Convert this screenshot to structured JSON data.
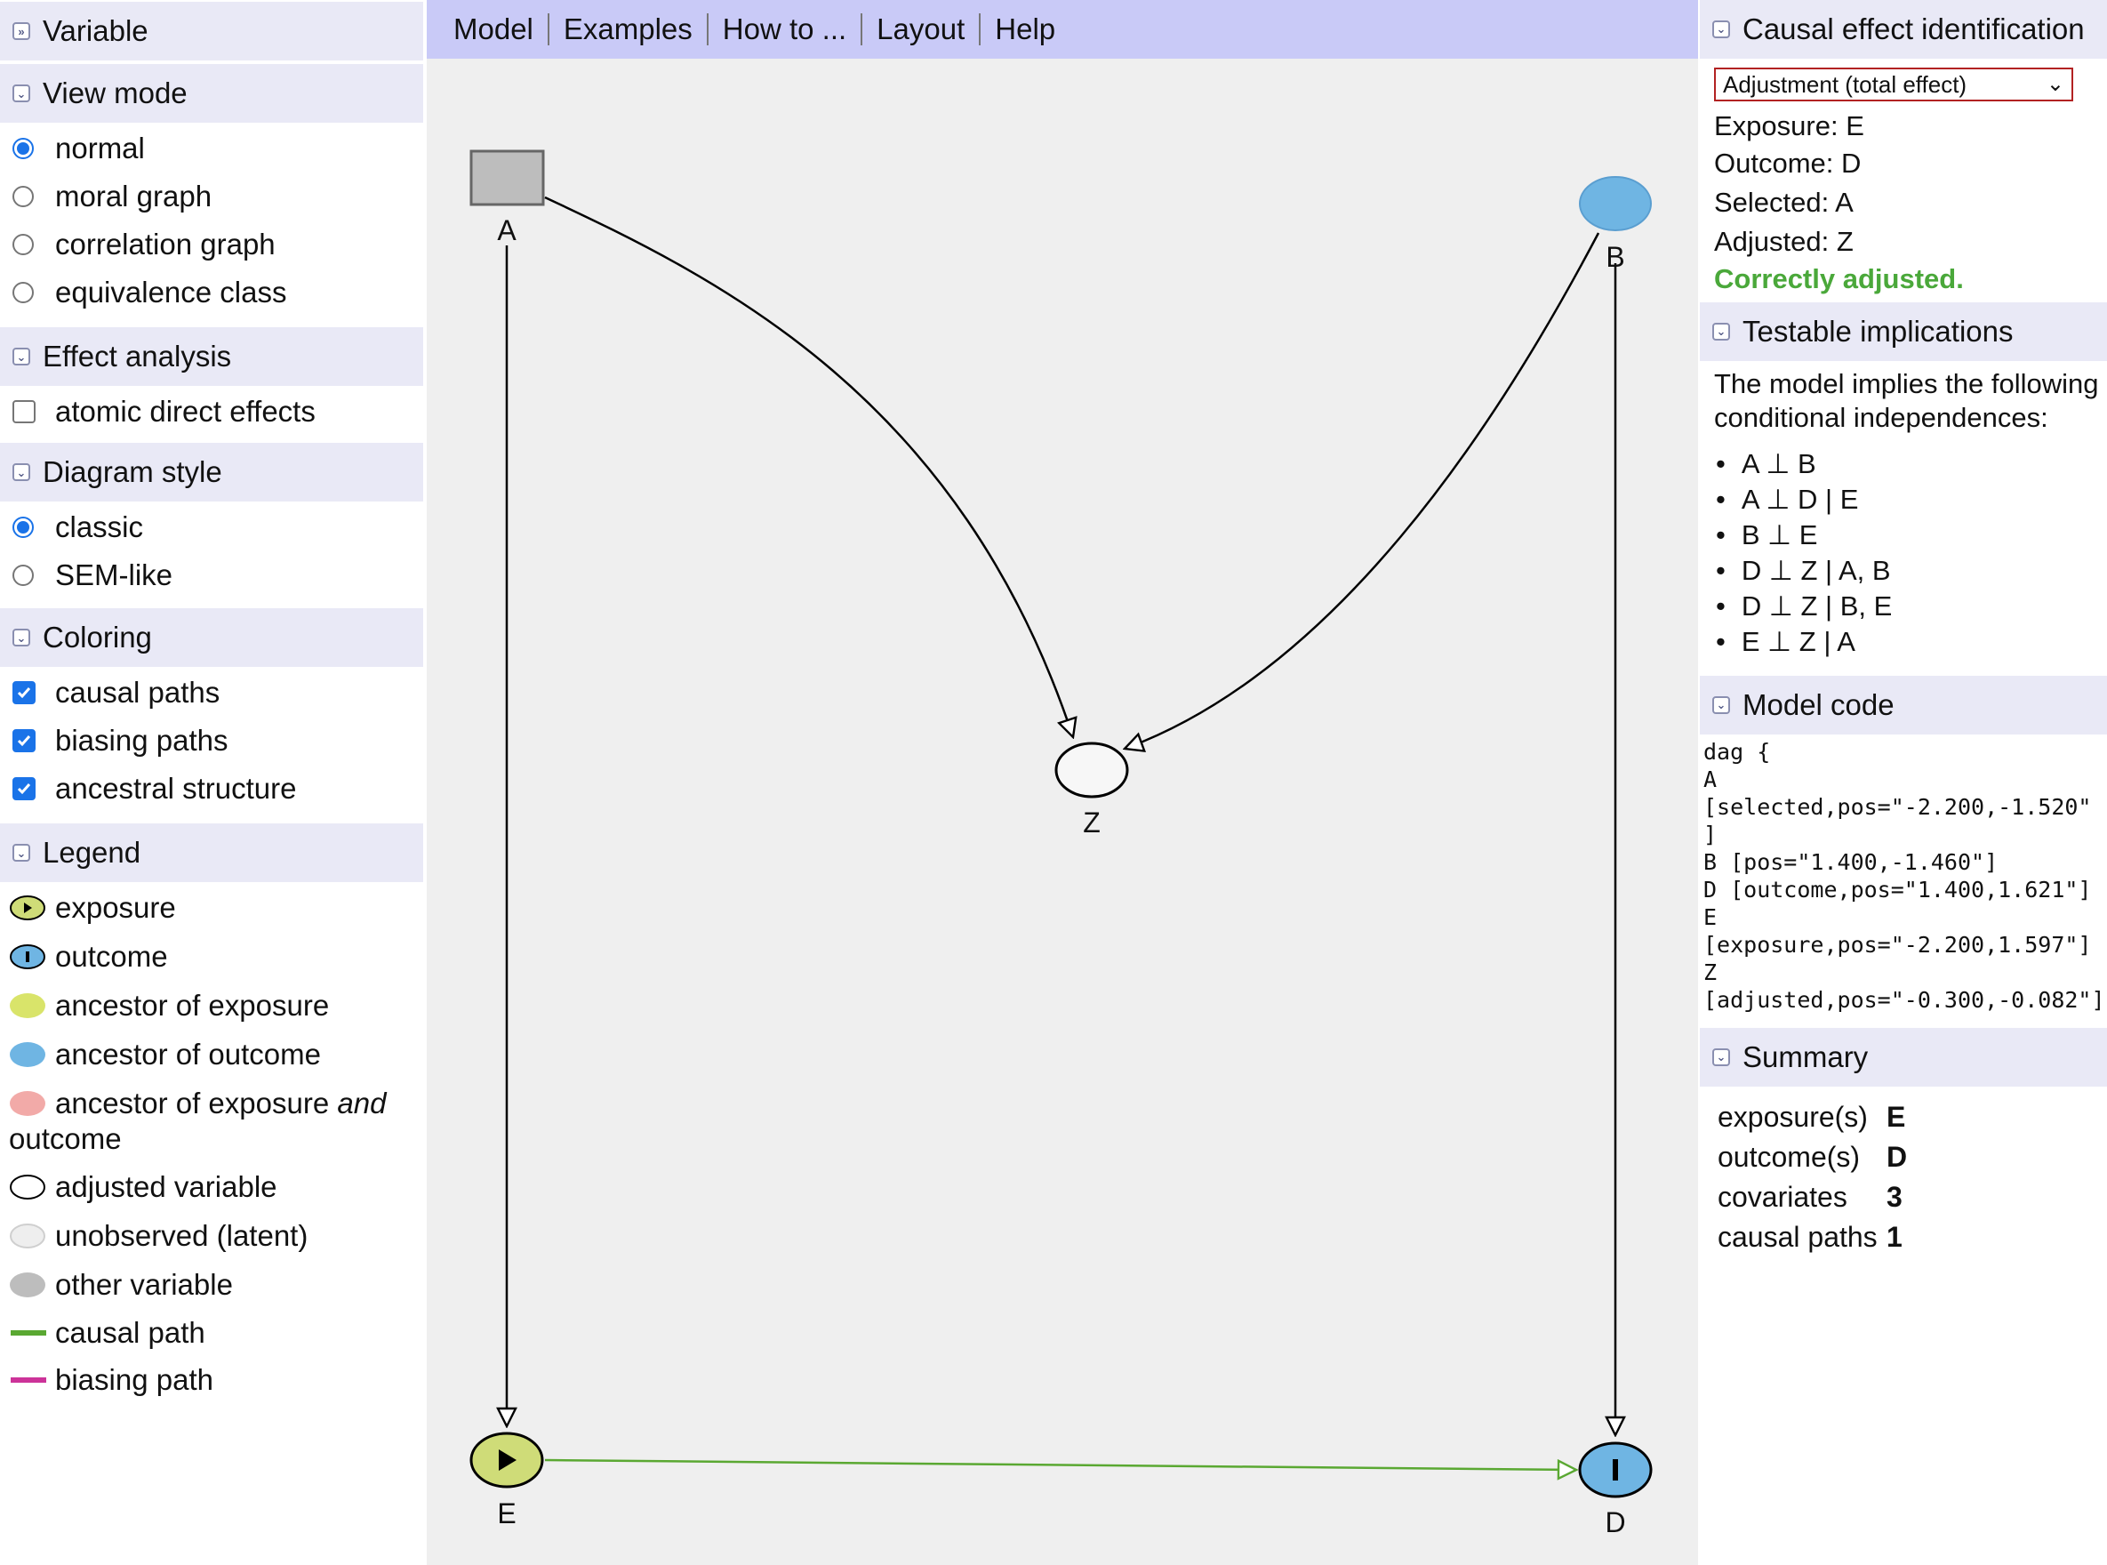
{
  "menubar": {
    "items": [
      "Model",
      "Examples",
      "How to ...",
      "Layout",
      "Help"
    ]
  },
  "left": {
    "variable": {
      "title": "Variable"
    },
    "view_mode": {
      "title": "View mode",
      "options": [
        "normal",
        "moral graph",
        "correlation graph",
        "equivalence class"
      ],
      "selected": "normal"
    },
    "effect_analysis": {
      "title": "Effect analysis",
      "options": [
        "atomic direct effects"
      ],
      "checked": [
        false
      ]
    },
    "diagram_style": {
      "title": "Diagram style",
      "options": [
        "classic",
        "SEM-like"
      ],
      "selected": "classic"
    },
    "coloring": {
      "title": "Coloring",
      "options": [
        "causal paths",
        "biasing paths",
        "ancestral structure"
      ],
      "checked": [
        true,
        true,
        true
      ]
    },
    "legend": {
      "title": "Legend",
      "items": {
        "exposure": "exposure",
        "outcome": "outcome",
        "anc_exposure": "ancestor of exposure",
        "anc_outcome": "ancestor of outcome",
        "anc_both_pre": "ancestor of exposure ",
        "anc_both_and": "and",
        "anc_both_post": "outcome",
        "adjusted": "adjusted variable",
        "unobserved": "unobserved (latent)",
        "other": "other variable",
        "causal_path": "causal path",
        "biasing_path": "biasing path"
      }
    }
  },
  "graph": {
    "nodes": {
      "A": "A",
      "B": "B",
      "Z": "Z",
      "E": "E",
      "D": "D"
    },
    "colors": {
      "exposure": "#cfdc78",
      "outcome": "#6fb5e3",
      "other": "#bdbdbd",
      "adjusted": "#f7f7f7",
      "causal_path": "#5aa832",
      "biasing_path": "#cc3399",
      "anc_exposure": "#d9e46a",
      "anc_both": "#f2aaa8",
      "unobserved": "#e8e8e8"
    }
  },
  "right": {
    "identification": {
      "title": "Causal effect identification",
      "select_value": "Adjustment (total effect)",
      "exposure": "Exposure: E",
      "outcome": "Outcome: D",
      "selected": "Selected: A",
      "adjusted": "Adjusted: Z",
      "status": "Correctly adjusted.",
      "status_color": "#4aa83a"
    },
    "testable": {
      "title": "Testable implications",
      "intro_line1": "The model implies the following",
      "intro_line2": "conditional independences:",
      "items": [
        "A ⊥ B",
        "A ⊥ D | E",
        "B ⊥ E",
        "D ⊥ Z | A, B",
        "D ⊥ Z | B, E",
        "E ⊥ Z | A"
      ]
    },
    "model_code": {
      "title": "Model code",
      "text": "dag {\nA\n[selected,pos=\"-2.200,-1.520\"\n]\nB [pos=\"1.400,-1.460\"]\nD [outcome,pos=\"1.400,1.621\"]\nE\n[exposure,pos=\"-2.200,1.597\"]\nZ\n[adjusted,pos=\"-0.300,-0.082\"]\n]"
    },
    "summary": {
      "title": "Summary",
      "rows": [
        {
          "label": "exposure(s)",
          "value": "E"
        },
        {
          "label": "outcome(s)",
          "value": "D"
        },
        {
          "label": "covariates",
          "value": "3"
        },
        {
          "label": "causal paths",
          "value": "1"
        }
      ]
    }
  }
}
